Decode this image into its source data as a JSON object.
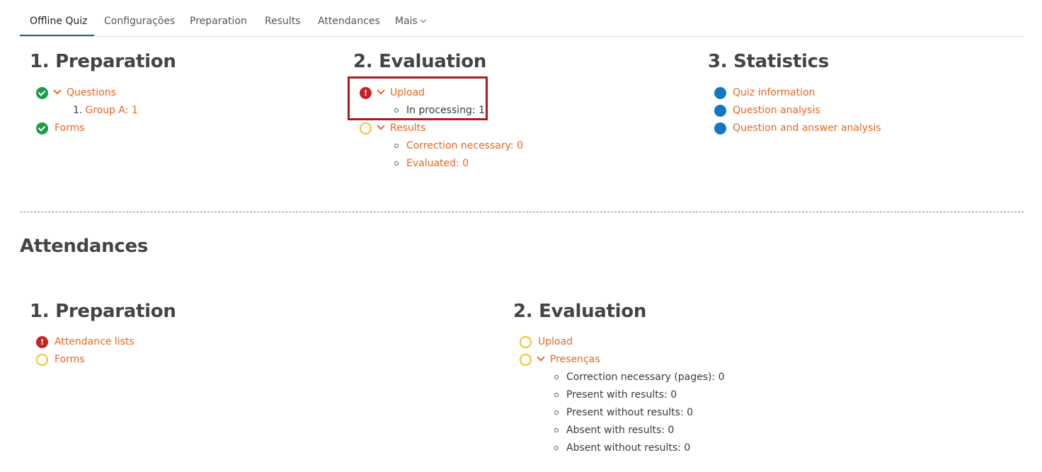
{
  "tabs": [
    {
      "label": "Offline Quiz"
    },
    {
      "label": "Configurações"
    },
    {
      "label": "Preparation"
    },
    {
      "label": "Results"
    },
    {
      "label": "Attendances"
    },
    {
      "label": "Mais"
    }
  ],
  "quiz": {
    "preparation": {
      "title": "1. Preparation",
      "questions_label": "Questions",
      "group_number": "1.",
      "group_label": "Group A: 1",
      "forms_label": "Forms"
    },
    "evaluation": {
      "title": "2. Evaluation",
      "upload_label": "Upload",
      "in_processing": "In processing: 1",
      "results_label": "Results",
      "correction_necessary": "Correction necessary: 0",
      "evaluated": "Evaluated: 0"
    },
    "statistics": {
      "title": "3. Statistics",
      "quiz_information": "Quiz information",
      "question_analysis": "Question analysis",
      "question_answer_analysis": "Question and answer analysis"
    }
  },
  "attendances": {
    "title": "Attendances",
    "preparation": {
      "title": "1. Preparation",
      "attendance_lists": "Attendance lists",
      "forms_label": "Forms"
    },
    "evaluation": {
      "title": "2. Evaluation",
      "upload_label": "Upload",
      "presencas_label": "Presenças",
      "items": [
        "Correction necessary (pages): 0",
        "Present with results: 0",
        "Present without results: 0",
        "Absent with results: 0",
        "Absent without results: 0"
      ]
    }
  },
  "colors": {
    "link": "#e8661f",
    "success": "#1a9e45",
    "error": "#c42424",
    "pending": "#f0c130",
    "info": "#1177c2",
    "highlight": "#b0191e"
  }
}
